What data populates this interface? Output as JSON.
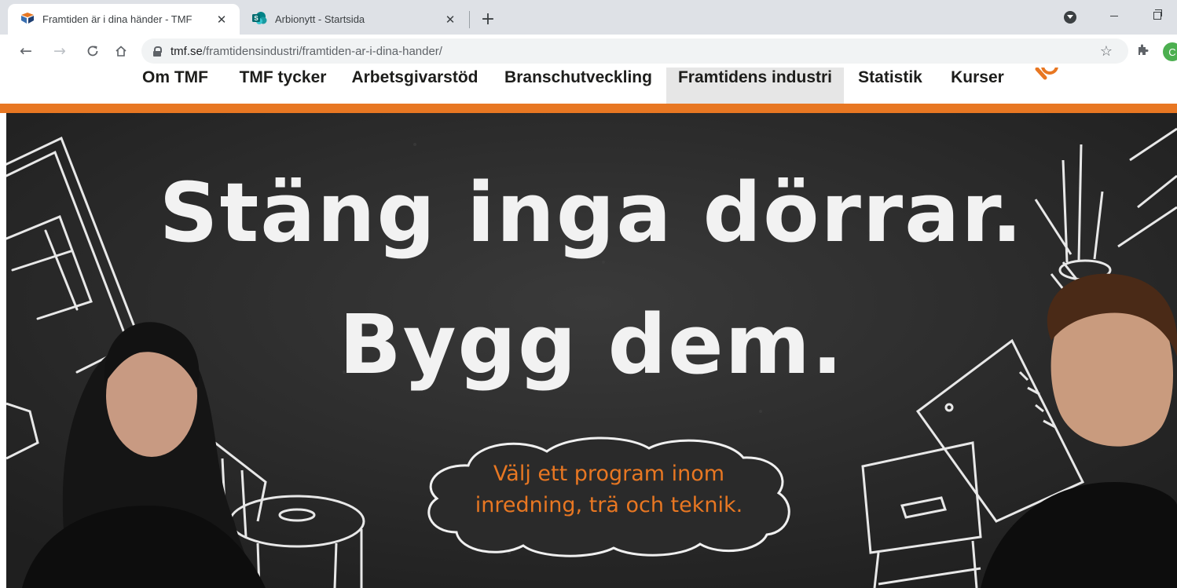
{
  "browser": {
    "tabs": [
      {
        "title": "Framtiden är i dina händer - TMF",
        "active": true,
        "icon": "tmf-logo-icon"
      },
      {
        "title": "Arbionytt - Startsida",
        "active": false,
        "icon": "sharepoint-icon"
      }
    ],
    "url_host": "tmf.se",
    "url_path": "/framtidensindustri/framtiden-ar-i-dina-hander/",
    "avatar_initial": "C"
  },
  "site_nav": {
    "items": [
      {
        "label": "Om TMF"
      },
      {
        "label": "TMF tycker"
      },
      {
        "label": "Arbetsgivarstöd"
      },
      {
        "label": "Branschutveckling"
      },
      {
        "label": "Framtidens industri",
        "active": true
      },
      {
        "label": "Statistik"
      },
      {
        "label": "Kurser"
      }
    ],
    "accent_color": "#e87722"
  },
  "hero": {
    "headline_line1": "Stäng inga dörrar.",
    "headline_line2": "Bygg dem.",
    "cloud_line1": "Välj ett program inom",
    "cloud_line2": "inredning, trä och teknik.",
    "background_color": "#2b2b2b",
    "text_color": "#f2f2f2",
    "cloud_text_color": "#e87722"
  }
}
